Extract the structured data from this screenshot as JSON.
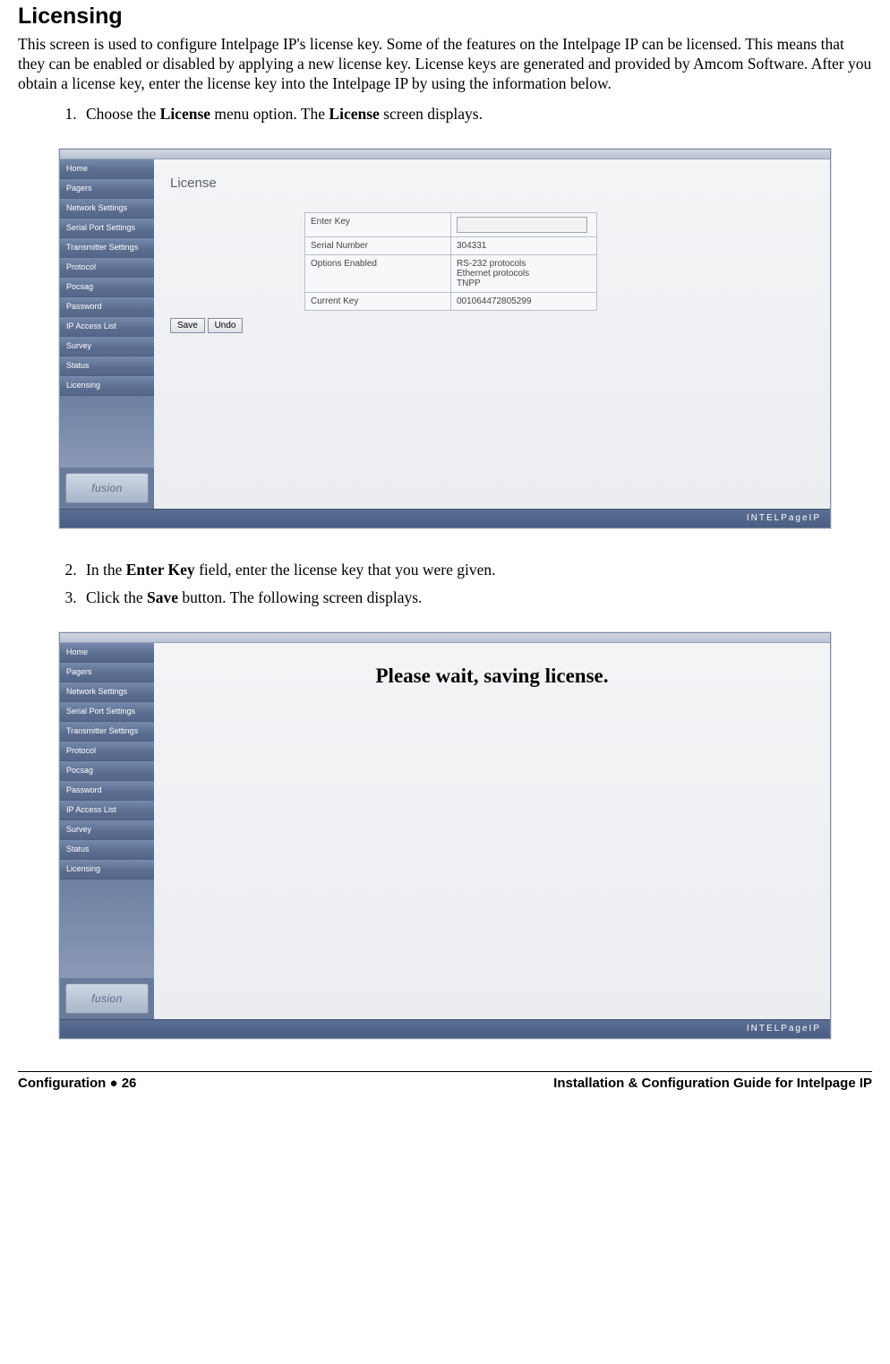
{
  "heading": "Licensing",
  "intro": "This screen is used to configure Intelpage IP's license key. Some of the features on the Intelpage IP can be licensed. This means that they can be enabled or disabled by applying a new license key. License keys are generated and provided by Amcom Software. After you obtain a license key, enter the license key into the Intelpage IP by using the information below.",
  "steps": {
    "s1_a": "Choose the ",
    "s1_b": "License",
    "s1_c": " menu option. The ",
    "s1_d": "License",
    "s1_e": " screen displays.",
    "s2_a": "In the ",
    "s2_b": "Enter Key",
    "s2_c": " field, enter the license key that you were given.",
    "s3_a": "Click the ",
    "s3_b": "Save",
    "s3_c": " button. The following screen displays."
  },
  "nav": [
    "Home",
    "Pagers",
    "Network Settings",
    "Serial Port Settings",
    "Transmitter Settings",
    "Protocol",
    "Pocsag",
    "Password",
    "IP Access List",
    "Survey",
    "Status",
    "Licensing"
  ],
  "logo_text": "fusion",
  "footer_brand": "INTELPageIP",
  "shot1": {
    "page_label": "License",
    "rows": {
      "enter_key_label": "Enter Key",
      "serial_label": "Serial Number",
      "serial_value": "304331",
      "options_label": "Options Enabled",
      "options_value_1": "RS-232 protocols",
      "options_value_2": "Ethernet protocols",
      "options_value_3": "TNPP",
      "current_label": "Current Key",
      "current_value": "001064472805299"
    },
    "save_btn": "Save",
    "undo_btn": "Undo"
  },
  "shot2": {
    "wait_msg": "Please wait, saving license."
  },
  "footer": {
    "left_a": "Configuration  ",
    "left_b": "●",
    "left_c": "  26",
    "right": "Installation & Configuration Guide for Intelpage IP"
  }
}
